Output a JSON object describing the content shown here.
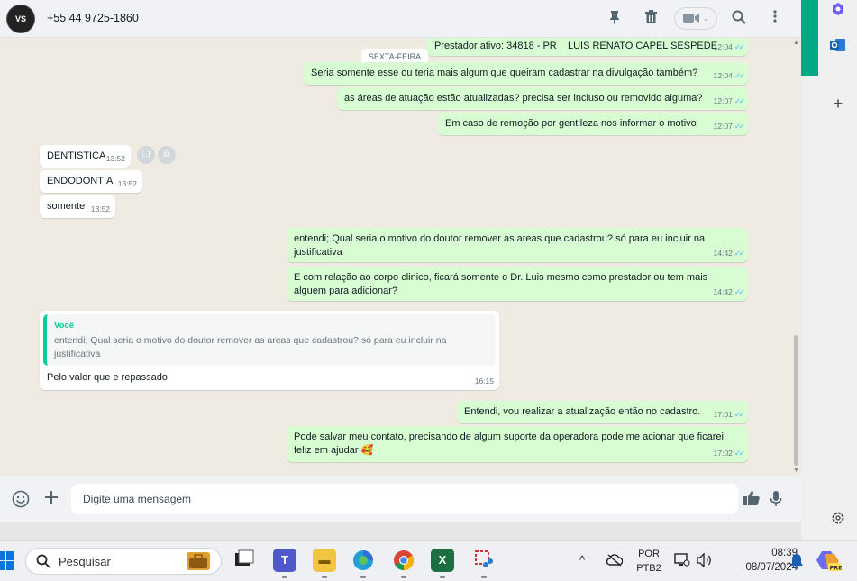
{
  "header": {
    "avatar_text": "VS",
    "contact": "+55 44 9725-1860",
    "icons": [
      "pin-icon",
      "trash-icon",
      "video-call-icon",
      "search-icon",
      "menu-icon"
    ]
  },
  "chat": {
    "day_chip": "SEXTA-FEIRA",
    "messages": [
      {
        "dir": "out",
        "text": "Prestador ativo: 34818 - PR    LUIS RENATO CAPEL SESPEDE",
        "time": "12:04"
      },
      {
        "dir": "out",
        "text": "Seria somente esse ou teria mais algum que queiram cadastrar na divulgação também?",
        "time": "12:04"
      },
      {
        "dir": "out",
        "text": "as áreas de atuação estão atualizadas? precisa ser incluso ou removido alguma?",
        "time": "12:07"
      },
      {
        "dir": "out",
        "text": "Em caso de remoção por gentileza nos informar o motivo",
        "time": "12:07"
      },
      {
        "dir": "in",
        "text": "DENTISTICA",
        "time": "13:52"
      },
      {
        "dir": "in",
        "text": "ENDODONTIA",
        "time": "13:52"
      },
      {
        "dir": "in",
        "text": "somente",
        "time": "13:52"
      },
      {
        "dir": "out",
        "text": "entendi; Qual seria o motivo do doutor remover as areas que cadastrou? só para eu incluir na justificativa",
        "time": "14:42"
      },
      {
        "dir": "out",
        "text": "E com relação ao corpo clinico, ficará somente o Dr. Luis mesmo como prestador ou tem mais alguem para adicionar?",
        "time": "14:42"
      },
      {
        "dir": "in",
        "quote_author": "Você",
        "quote_text": "entendi; Qual seria o motivo do doutor remover as areas que cadastrou? só para eu incluir na justificativa",
        "text": "Pelo valor que e repassado",
        "time": "16:15"
      },
      {
        "dir": "out",
        "text": "Entendi, vou realizar a atualização então no cadastro.",
        "time": "17:01"
      },
      {
        "dir": "out",
        "text": "Pode salvar meu contato, precisando de algum suporte da operadora pode me acionar que ficarei feliz em ajudar 🥰",
        "time": "17:02"
      }
    ]
  },
  "composer": {
    "placeholder": "Digite uma mensagem",
    "icons": [
      "emoji-icon",
      "attach-plus-icon",
      "thumbs-up-icon",
      "microphone-icon"
    ]
  },
  "side_panel": {
    "icons": [
      "copilot-icon",
      "outlook-icon",
      "add-icon",
      "settings-icon"
    ]
  },
  "taskbar": {
    "search_label": "Pesquisar",
    "apps": [
      "windows-start-icon",
      "work-briefcase-icon",
      "task-view-icon",
      "teams-icon",
      "file-explorer-icon",
      "edge-icon",
      "chrome-icon",
      "excel-icon",
      "snipping-tool-icon"
    ],
    "tray": {
      "lang_top": "POR",
      "lang_bottom": "PTB2",
      "time": "08:39",
      "date": "08/07/2024"
    }
  }
}
